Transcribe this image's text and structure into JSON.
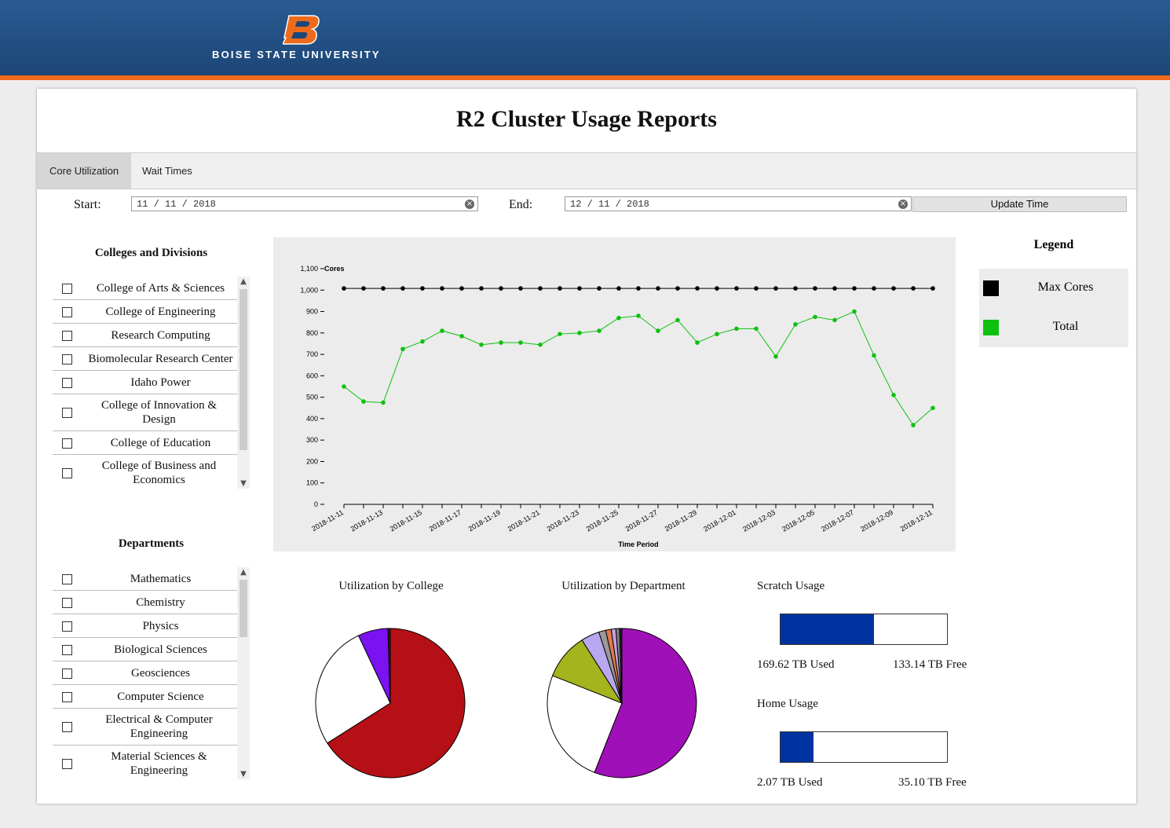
{
  "header": {
    "brand": "BOISE STATE UNIVERSITY",
    "logo_letter": "B",
    "brand_color": "#1d4677",
    "accent_color": "#ee6b1c"
  },
  "page_title": "R2 Cluster Usage Reports",
  "tabs": [
    {
      "label": "Core Utilization",
      "active": true
    },
    {
      "label": "Wait Times",
      "active": false
    }
  ],
  "date_range": {
    "start_label": "Start:",
    "start_value": "11 / 11 / 2018",
    "end_label": "End:",
    "end_value": "12 / 11 / 2018",
    "update_label": "Update Time"
  },
  "colleges": {
    "title": "Colleges and Divisions",
    "items": [
      "College of Arts & Sciences",
      "College of Engineering",
      "Research Computing",
      "Biomolecular Research Center",
      "Idaho Power",
      "College of Innovation & Design",
      "College of Education",
      "College of Business and Economics"
    ]
  },
  "departments": {
    "title": "Departments",
    "items": [
      "Mathematics",
      "Chemistry",
      "Physics",
      "Biological Sciences",
      "Geosciences",
      "Computer Science",
      "Electrical & Computer Engineering",
      "Material Sciences & Engineering"
    ]
  },
  "legend": {
    "title": "Legend",
    "items": [
      {
        "label": "Max Cores",
        "color": "#000000"
      },
      {
        "label": "Total",
        "color": "#0fc10f"
      }
    ]
  },
  "chart_data": [
    {
      "type": "line",
      "ylabel": "Cores",
      "xlabel": "Time Period",
      "ylim": [
        0,
        1100
      ],
      "yticks": [
        0,
        100,
        200,
        300,
        400,
        500,
        600,
        700,
        800,
        900,
        1000,
        1100
      ],
      "ytick_labels": [
        "0",
        "100",
        "200",
        "300",
        "400",
        "500",
        "600",
        "700",
        "800",
        "900",
        "1,000",
        "1,100"
      ],
      "x": [
        "2018-11-11",
        "2018-11-12",
        "2018-11-13",
        "2018-11-14",
        "2018-11-15",
        "2018-11-16",
        "2018-11-17",
        "2018-11-18",
        "2018-11-19",
        "2018-11-20",
        "2018-11-21",
        "2018-11-22",
        "2018-11-23",
        "2018-11-24",
        "2018-11-25",
        "2018-11-26",
        "2018-11-27",
        "2018-11-28",
        "2018-11-29",
        "2018-11-30",
        "2018-12-01",
        "2018-12-02",
        "2018-12-03",
        "2018-12-04",
        "2018-12-05",
        "2018-12-06",
        "2018-12-07",
        "2018-12-08",
        "2018-12-09",
        "2018-12-10",
        "2018-12-11"
      ],
      "xtick_labels": [
        "2018-11-11",
        "2018-11-13",
        "2018-11-15",
        "2018-11-17",
        "2018-11-19",
        "2018-11-21",
        "2018-11-23",
        "2018-11-25",
        "2018-11-27",
        "2018-11-29",
        "2018-12-01",
        "2018-12-03",
        "2018-12-05",
        "2018-12-07",
        "2018-12-09",
        "2018-12-11"
      ],
      "series": [
        {
          "name": "Max Cores",
          "color": "#000000",
          "values": [
            1008,
            1008,
            1008,
            1008,
            1008,
            1008,
            1008,
            1008,
            1008,
            1008,
            1008,
            1008,
            1008,
            1008,
            1008,
            1008,
            1008,
            1008,
            1008,
            1008,
            1008,
            1008,
            1008,
            1008,
            1008,
            1008,
            1008,
            1008,
            1008,
            1008,
            1008
          ]
        },
        {
          "name": "Total",
          "color": "#0fc10f",
          "values": [
            550,
            480,
            475,
            725,
            760,
            810,
            785,
            745,
            755,
            755,
            745,
            795,
            800,
            810,
            870,
            880,
            810,
            860,
            755,
            795,
            820,
            820,
            690,
            840,
            875,
            860,
            900,
            695,
            510,
            370,
            450
          ]
        }
      ]
    },
    {
      "type": "pie",
      "title": "Utilization by College",
      "values": [
        66,
        27,
        6.5,
        0.5
      ],
      "colors": [
        "#b51016",
        "#ffffff",
        "#7a12f2",
        "#222222"
      ]
    },
    {
      "type": "pie",
      "title": "Utilization by Department",
      "values": [
        56,
        25,
        10,
        4,
        1.5,
        1.2,
        1.0,
        0.8,
        0.5
      ],
      "colors": [
        "#a010b8",
        "#ffffff",
        "#a4b41c",
        "#b8a8f0",
        "#9a9a9a",
        "#e07848",
        "#c8a0e0",
        "#808080",
        "#222222"
      ]
    }
  ],
  "scratch": {
    "title": "Scratch Usage",
    "used_label": "169.62 TB Used",
    "free_label": "133.14 TB Free",
    "used_fraction": 0.56,
    "fill_color": "#0033a0"
  },
  "home": {
    "title": "Home Usage",
    "used_label": "2.07 TB Used",
    "free_label": "35.10 TB Free",
    "used_fraction": 0.2,
    "fill_color": "#0033a0"
  }
}
